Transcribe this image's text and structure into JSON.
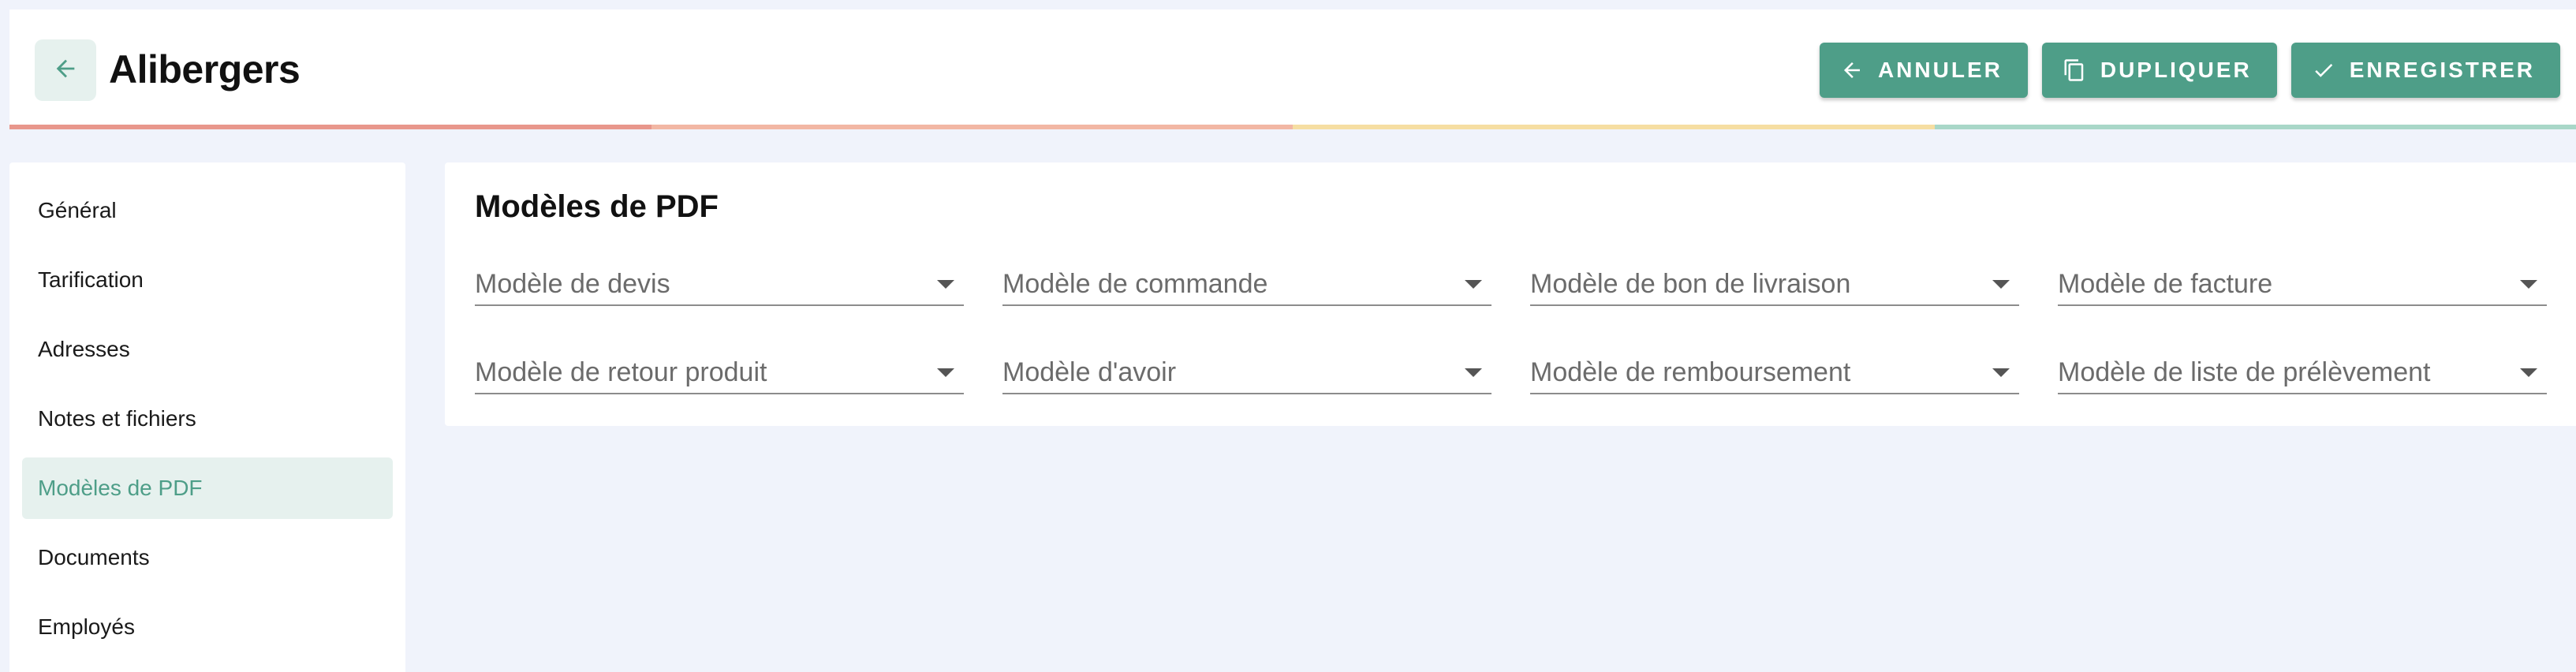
{
  "header": {
    "title": "Alibergers",
    "actions": [
      {
        "label": "ANNULER",
        "icon": "arrow-left-icon"
      },
      {
        "label": "DUPLIQUER",
        "icon": "copy-icon"
      },
      {
        "label": "ENREGISTRER",
        "icon": "check-icon"
      }
    ],
    "progress_colors": [
      "#e8978c",
      "#f2b7a4",
      "#f6dea2",
      "#a9d7c8"
    ]
  },
  "sidebar": {
    "items": [
      {
        "label": "Général"
      },
      {
        "label": "Tarification"
      },
      {
        "label": "Adresses"
      },
      {
        "label": "Notes et fichiers"
      },
      {
        "label": "Modèles de PDF",
        "active": true
      },
      {
        "label": "Documents"
      },
      {
        "label": "Employés"
      }
    ]
  },
  "main": {
    "title": "Modèles de PDF",
    "selects": [
      {
        "placeholder": "Modèle de devis",
        "value": ""
      },
      {
        "placeholder": "Modèle de commande",
        "value": ""
      },
      {
        "placeholder": "Modèle de bon de livraison",
        "value": ""
      },
      {
        "placeholder": "Modèle de facture",
        "value": ""
      },
      {
        "placeholder": "Modèle de retour produit",
        "value": ""
      },
      {
        "placeholder": "Modèle d'avoir",
        "value": ""
      },
      {
        "placeholder": "Modèle de remboursement",
        "value": ""
      },
      {
        "placeholder": "Modèle de liste de prélèvement",
        "value": ""
      }
    ]
  },
  "colors": {
    "accent": "#4e9e88",
    "accent_light": "#e6f1ee",
    "background": "#f0f3fb"
  }
}
